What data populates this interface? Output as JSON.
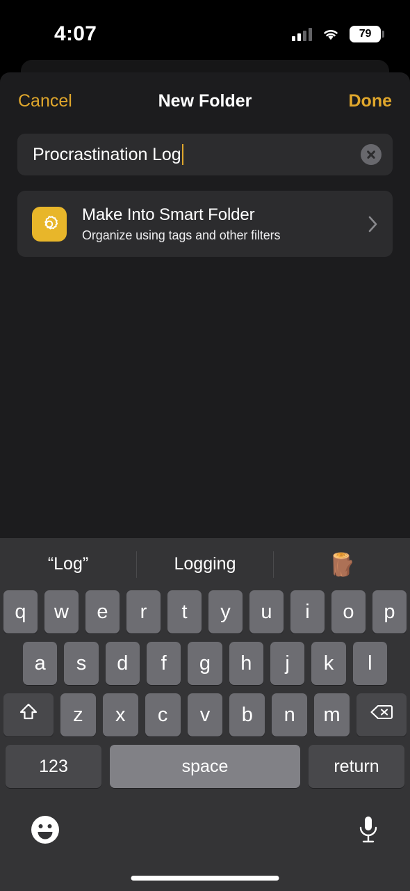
{
  "status_bar": {
    "time": "4:07",
    "battery_level": "79",
    "signal_icon": "cellular-bars-icon",
    "wifi_icon": "wifi-icon",
    "battery_icon": "battery-icon"
  },
  "nav_bar": {
    "cancel_label": "Cancel",
    "title": "New Folder",
    "done_label": "Done",
    "accent_color": "#e0a72c"
  },
  "name_field": {
    "value": "Procrastination Log",
    "placeholder": "Name",
    "clear_icon": "clear-circle-icon",
    "caret_color": "#e0a72c"
  },
  "smart_folder_row": {
    "icon": "gear-icon",
    "icon_bg_color": "#e8b62a",
    "title": "Make Into Smart Folder",
    "subtitle": "Organize using tags and other filters",
    "chevron_icon": "chevron-right-icon"
  },
  "keyboard": {
    "predictions": [
      {
        "label": "“Log”",
        "kind": "text"
      },
      {
        "label": "Logging",
        "kind": "text"
      },
      {
        "label": "🪵",
        "kind": "emoji"
      }
    ],
    "row1": [
      "q",
      "w",
      "e",
      "r",
      "t",
      "y",
      "u",
      "i",
      "o",
      "p"
    ],
    "row2": [
      "a",
      "s",
      "d",
      "f",
      "g",
      "h",
      "j",
      "k",
      "l"
    ],
    "row3": [
      "z",
      "x",
      "c",
      "v",
      "b",
      "n",
      "m"
    ],
    "shift_icon": "shift-arrow-icon",
    "backspace_icon": "backspace-icon",
    "numbers_label": "123",
    "space_label": "space",
    "return_label": "return",
    "emoji_icon": "emoji-smiley-icon",
    "dictation_icon": "microphone-icon",
    "key_color": "#6d6d72",
    "special_key_color": "#48484b",
    "space_key_color": "#818186",
    "background_color": "#343436"
  },
  "home_indicator": "home-indicator"
}
